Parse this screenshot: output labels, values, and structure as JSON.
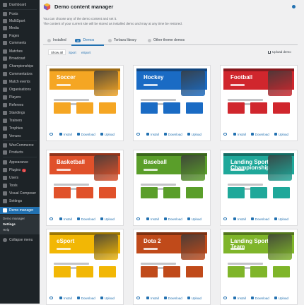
{
  "sidebar": {
    "items": [
      {
        "label": "Dashboard",
        "icon": "dashboard-icon"
      },
      {
        "label": "Posts",
        "icon": "pushpin-icon"
      },
      {
        "label": "MultiSport",
        "icon": "trophy-icon"
      },
      {
        "label": "Media",
        "icon": "media-icon"
      },
      {
        "label": "Pages",
        "icon": "page-icon"
      },
      {
        "label": "Comments",
        "icon": "comment-icon"
      },
      {
        "label": "Matches",
        "icon": "match-icon"
      },
      {
        "label": "Broadcast",
        "icon": "broadcast-icon"
      },
      {
        "label": "Championships",
        "icon": "championship-icon"
      },
      {
        "label": "Commentators",
        "icon": "commentator-icon"
      },
      {
        "label": "Match events",
        "icon": "event-icon"
      },
      {
        "label": "Organisations",
        "icon": "organisation-icon"
      },
      {
        "label": "Players",
        "icon": "player-icon"
      },
      {
        "label": "Referees",
        "icon": "referee-icon"
      },
      {
        "label": "Standings",
        "icon": "standings-icon"
      },
      {
        "label": "Trainers",
        "icon": "trainer-icon"
      },
      {
        "label": "Trophies",
        "icon": "trophy-icon"
      },
      {
        "label": "Venues",
        "icon": "venue-icon"
      },
      {
        "label": "WooCommerce",
        "icon": "woocommerce-icon"
      },
      {
        "label": "Products",
        "icon": "product-icon"
      },
      {
        "label": "Appearance",
        "icon": "appearance-icon"
      },
      {
        "label": "Plugins",
        "icon": "plugin-icon",
        "badge": "1"
      },
      {
        "label": "Users",
        "icon": "user-icon"
      },
      {
        "label": "Tools",
        "icon": "tools-icon"
      },
      {
        "label": "Visual Composer",
        "icon": "composer-icon"
      },
      {
        "label": "Settings",
        "icon": "settings-icon"
      },
      {
        "label": "Demo manager",
        "icon": "demo-manager-icon"
      }
    ],
    "submenu": [
      "Demo manager",
      "Settings",
      "Help"
    ],
    "collapse_label": "Collapse menu"
  },
  "header": {
    "title": "Demo content manager",
    "description_line1": "You can choose any of the demo content and set it.",
    "description_line2": "The content of your current site will be stored as installed demo and may at any time be restored."
  },
  "tabs": [
    {
      "label": "Installed",
      "badge": ""
    },
    {
      "label": "Demos",
      "badge": "14"
    },
    {
      "label": "Torbara library",
      "badge": ""
    },
    {
      "label": "Other theme demos",
      "badge": ""
    }
  ],
  "filters": [
    "Show all",
    "Sport",
    "eSport"
  ],
  "upload_demo_label": "Upload demo",
  "card_actions": {
    "install": "Install",
    "download": "Download",
    "upload": "Upload"
  },
  "demos": [
    {
      "title": "Soccer",
      "color": "#f5a623"
    },
    {
      "title": "Hockey",
      "color": "#1a6bc4"
    },
    {
      "title": "Football",
      "color": "#d0262d"
    },
    {
      "title": "Basketball",
      "color": "#e0512a"
    },
    {
      "title": "Baseball",
      "color": "#5a9e2a"
    },
    {
      "title": "Landing Sport Championship",
      "color": "#1fa89a"
    },
    {
      "title": "eSport",
      "color": "#f2b705"
    },
    {
      "title": "Dota 2",
      "color": "#c04a1a"
    },
    {
      "title": "Landing Sport Team",
      "color": "#7fb52a"
    }
  ],
  "colors": {
    "accent": "#2271b1",
    "sidebar_bg": "#1d2327",
    "badge": "#d63638"
  }
}
